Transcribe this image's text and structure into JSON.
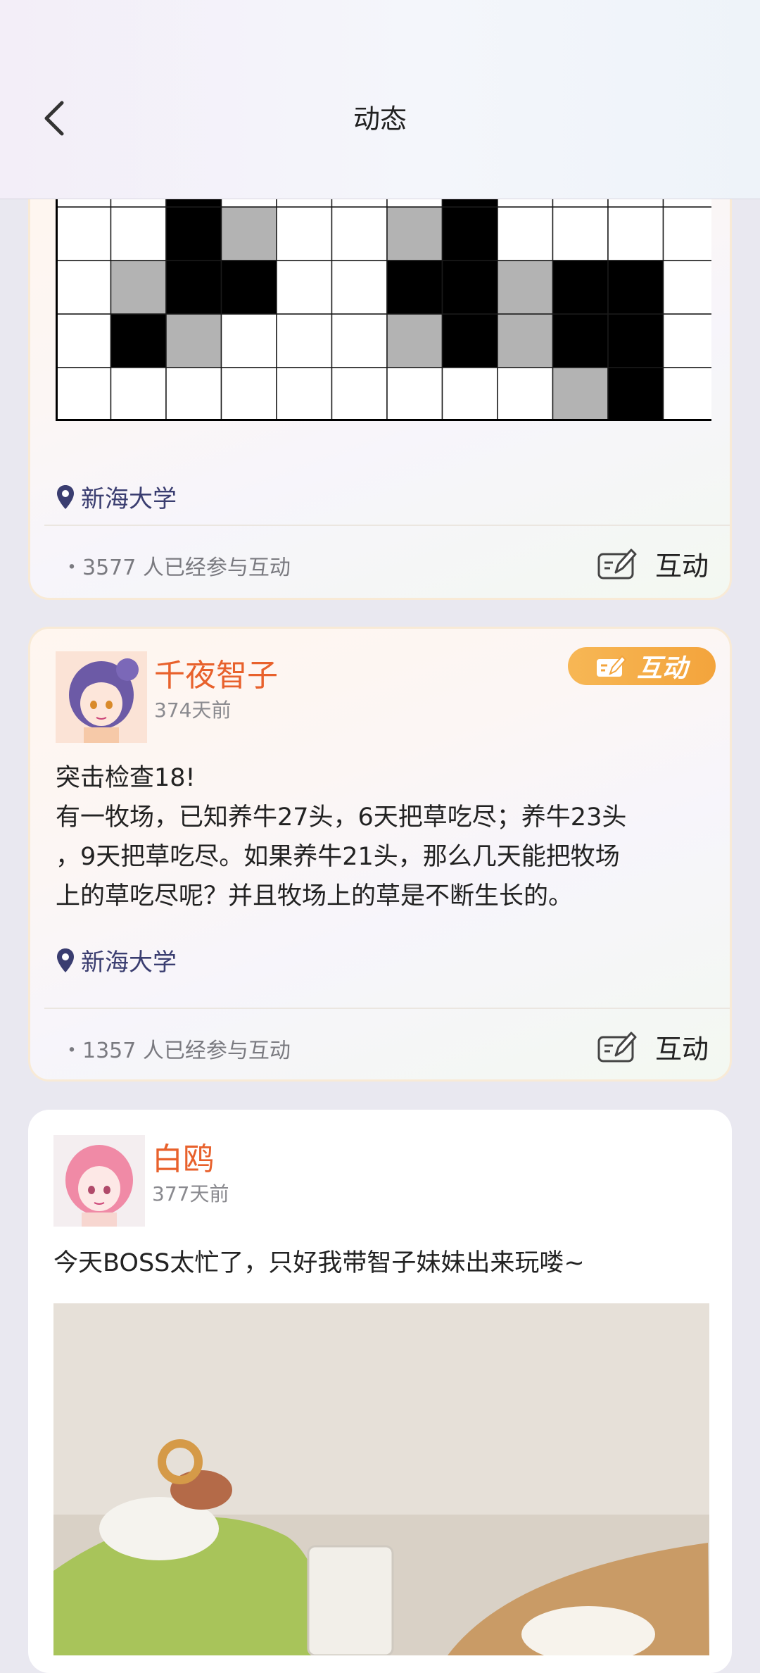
{
  "header": {
    "title": "动态"
  },
  "posts": [
    {
      "location": "新海大学",
      "count_text": "・3577  人已经参与互动",
      "interact_label": "互动"
    },
    {
      "user": "千夜智子",
      "time": "374天前",
      "badge_label": "互动",
      "content": "突击检查18!\n有一牧场，已知养牛27头，6天把草吃尽；养牛23头\n，9天把草吃尽。如果养牛21头，那么几天能把牧场\n上的草吃尽呢？并且牧场上的草是不断生长的。",
      "location": "新海大学",
      "count_text": "・1357  人已经参与互动",
      "interact_label": "互动"
    },
    {
      "user": "白鸥",
      "time": "377天前",
      "content": "今天BOSS太忙了，只好我带智子妹妹出来玩喽~"
    }
  ],
  "grid": {
    "columns": 12,
    "rows": [
      [
        "w",
        "w",
        "b",
        "w",
        "w",
        "w",
        "w",
        "b",
        "w",
        "w",
        "w",
        "w"
      ],
      [
        "w",
        "w",
        "b",
        "g",
        "w",
        "w",
        "g",
        "b",
        "w",
        "w",
        "w",
        "w"
      ],
      [
        "w",
        "g",
        "b",
        "b",
        "w",
        "w",
        "b",
        "b",
        "g",
        "b",
        "b",
        "w"
      ],
      [
        "w",
        "b",
        "g",
        "w",
        "w",
        "w",
        "g",
        "b",
        "g",
        "b",
        "b",
        "w"
      ],
      [
        "w",
        "w",
        "w",
        "w",
        "w",
        "w",
        "w",
        "w",
        "w",
        "g",
        "b",
        "w"
      ]
    ],
    "colors": {
      "w": "#ffffff",
      "b": "#000000",
      "g": "#b3b3b3"
    }
  },
  "colors": {
    "accent_name": "#e8612c",
    "location": "#3a3d70",
    "badge": "#f5ad46"
  },
  "icons": {
    "back": "chevron-left-icon",
    "location": "location-pin-icon",
    "interact": "edit-note-icon"
  }
}
